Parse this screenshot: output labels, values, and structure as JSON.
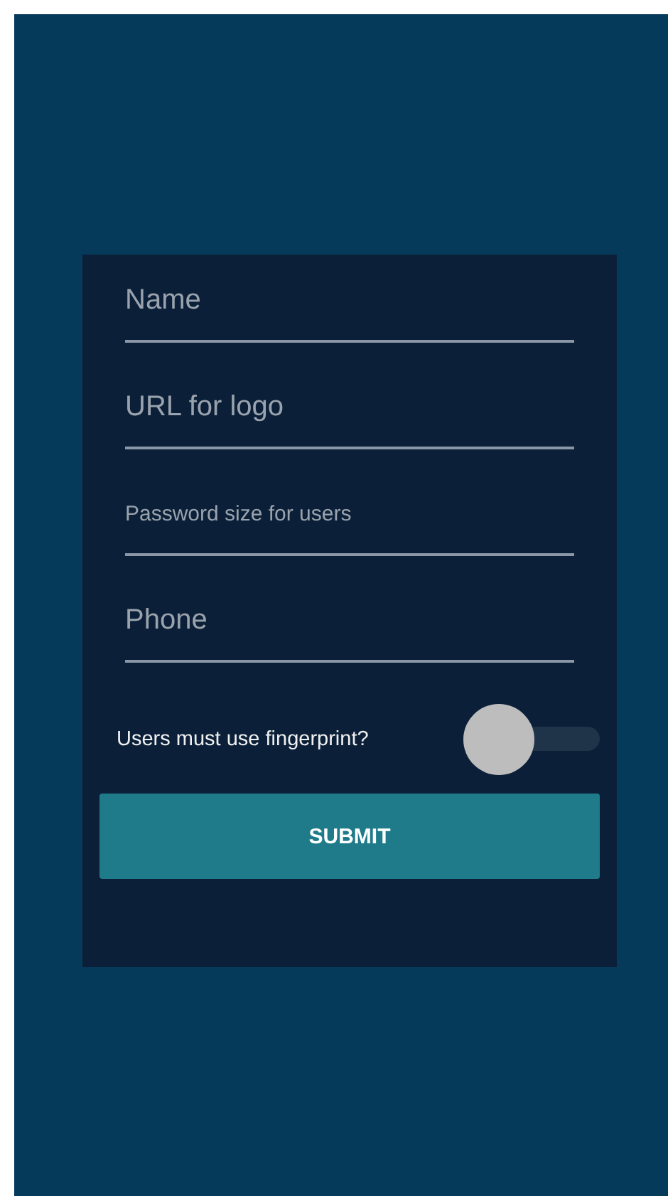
{
  "form": {
    "fields": [
      {
        "placeholder": "Name",
        "kind": "regular"
      },
      {
        "placeholder": "URL for logo",
        "kind": "regular"
      },
      {
        "placeholder": "Password size for users",
        "kind": "compact"
      },
      {
        "placeholder": "Phone",
        "kind": "regular"
      }
    ],
    "toggle": {
      "label": "Users must use fingerprint?",
      "on": false
    },
    "submit": "SUBMIT"
  }
}
